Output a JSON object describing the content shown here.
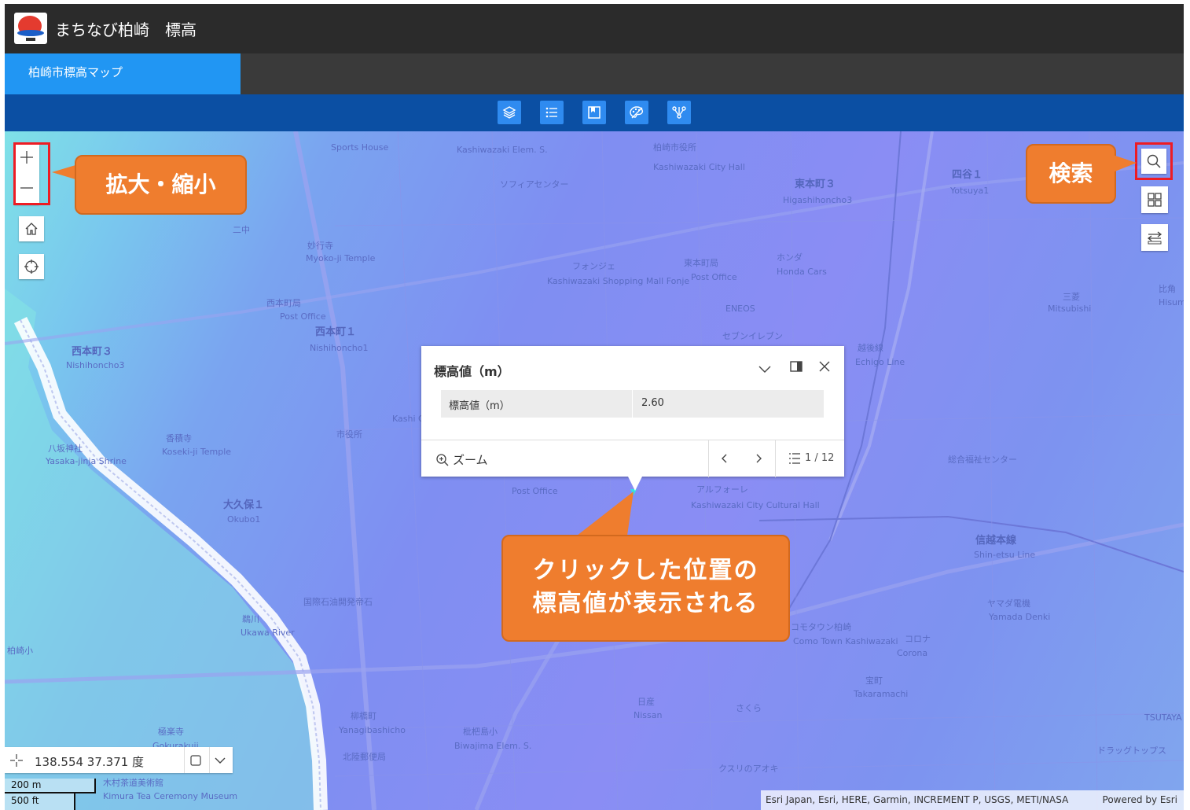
{
  "header": {
    "app_title": "まちなび柏崎　標高"
  },
  "tabs": [
    {
      "label": "柏崎市標高マップ",
      "active": true
    }
  ],
  "toolbar": {
    "buttons": [
      "layers-icon",
      "legend-icon",
      "bookmark-icon",
      "basemap-icon",
      "share-icon"
    ]
  },
  "map": {
    "labels": [
      "Sports House",
      "Kashiwazaki Elem. S.",
      "柏崎市役所",
      "Kashiwazaki City Hall",
      "ソフィアセンター",
      "東本町３",
      "Higashihoncho3",
      "四谷１",
      "Yotsuya1",
      "妙行寺",
      "Myoko-ji Temple",
      "フォンジェ",
      "Kashiwazaki Shopping Mall Fonje",
      "東本町局",
      "Post Office",
      "ホンダ",
      "Honda Cars",
      "西本町局",
      "Post Office",
      "西本町１",
      "Nishihoncho1",
      "ENEOS",
      "セブンイレブン",
      "西本町３",
      "Nishihoncho3",
      "三菱",
      "Mitsubishi",
      "比角",
      "Hisumi Elem.",
      "八坂神社",
      "Yasaka-jinja Shrine",
      "香積寺",
      "Koseki-ji Temple",
      "市役所",
      "Kashi Central",
      "大久保１",
      "Okubo1",
      "Post Office",
      "アルフォーレ",
      "Kashiwazaki City Cultural Hall",
      "総合福祉センター",
      "越後線",
      "Echigo Line",
      "信越本線",
      "Shin-etsu Line",
      "国際石油開発帝石",
      "鵜川",
      "Ukawa River",
      "ヤマダ電機",
      "Yamada Denki",
      "コモタウン柏崎",
      "Como Town Kashiwazaki",
      "コロナ",
      "Corona",
      "宝町",
      "Takaramachi",
      "日産",
      "Nissan",
      "さくら",
      "クスリのアオキ",
      "枇杷島小",
      "Biwajima Elem. S.",
      "柳橋町",
      "Yanagibashicho",
      "北陸郵便局",
      "極楽寺",
      "Gokurakuji",
      "木村茶道美術館",
      "Kimura Tea Ceremony Museum",
      "ドラッグトップス",
      "TSUTAYA",
      "柏崎小",
      "二中"
    ]
  },
  "popup": {
    "title": "標高値（m）",
    "field_label": "標高値（m）",
    "field_value": "2.60",
    "zoom_label": "ズーム",
    "pager": "1 / 12"
  },
  "annotations": {
    "zoom": "拡大・縮小",
    "search": "検索",
    "click_1": "クリックした位置の",
    "click_2": "標高値が表示される"
  },
  "coordinates": {
    "text": "138.554 37.371 度"
  },
  "scalebar": {
    "metric": "200 m",
    "imperial": "500 ft"
  },
  "attribution": {
    "text": "Esri Japan, Esri, HERE, Garmin, INCREMENT P, USGS, METI/NASA",
    "powered": "Powered by Esri"
  },
  "colors": {
    "header": "#2b2b2b",
    "tab_active": "#2196f3",
    "toolbar": "#0b4fa3",
    "callout": "#ef7d2e",
    "highlight": "#ee1c24"
  }
}
